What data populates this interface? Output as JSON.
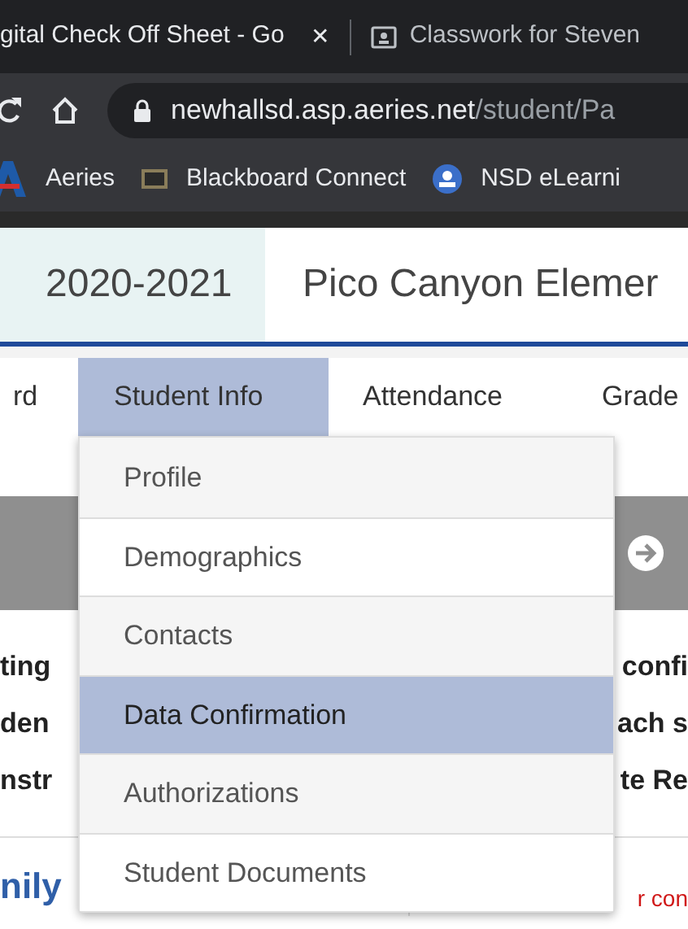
{
  "browser": {
    "tabs": [
      {
        "title": "gital Check Off Sheet - Go",
        "selected": true,
        "close": "✕"
      },
      {
        "title": "Classwork for Steven",
        "selected": false
      }
    ],
    "url_host": "newhallsd.asp.aeries.net",
    "url_path": "/student/Pa",
    "bookmarks": [
      {
        "label": "Aeries"
      },
      {
        "label": "Blackboard Connect"
      },
      {
        "label": "NSD eLearni"
      }
    ]
  },
  "header": {
    "school_year": "2020-2021",
    "school": "Pico Canyon Elemer"
  },
  "nav": [
    {
      "label": "rd",
      "selected": false
    },
    {
      "label": "Student Info",
      "selected": true
    },
    {
      "label": "Attendance",
      "selected": false
    },
    {
      "label": "Grade",
      "selected": false
    }
  ],
  "menu": [
    {
      "label": "Profile",
      "selected": false
    },
    {
      "label": "Demographics",
      "selected": false
    },
    {
      "label": "Contacts",
      "selected": false
    },
    {
      "label": "Data Confirmation",
      "selected": true
    },
    {
      "label": "Authorizations",
      "selected": false
    },
    {
      "label": "Student Documents",
      "selected": false
    }
  ],
  "background": {
    "lines": [
      {
        "left": "ting",
        "right": "confi"
      },
      {
        "left": "den",
        "right": "ach s"
      },
      {
        "left": "nstr",
        "right": "te Re"
      }
    ],
    "footer_left": "nily",
    "footer_right": "r con"
  }
}
